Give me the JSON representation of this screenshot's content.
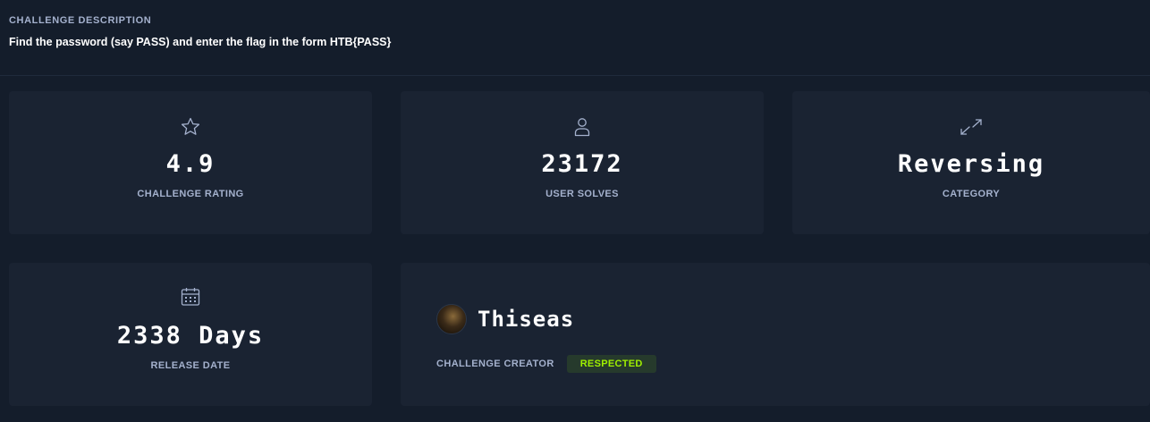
{
  "description": {
    "heading": "CHALLENGE DESCRIPTION",
    "text": "Find the password (say PASS) and enter the flag in the form HTB{PASS}"
  },
  "stats": [
    {
      "icon": "star-icon",
      "value": "4.9",
      "label": "CHALLENGE RATING"
    },
    {
      "icon": "user-icon",
      "value": "23172",
      "label": "USER SOLVES"
    },
    {
      "icon": "expand-arrows-icon",
      "value": "Reversing",
      "label": "CATEGORY"
    },
    {
      "icon": "calendar-icon",
      "value": "2338 Days",
      "label": "RELEASE DATE"
    }
  ],
  "creator": {
    "name": "Thiseas",
    "label": "CHALLENGE CREATOR",
    "badge": "RESPECTED"
  },
  "colors": {
    "background": "#141d2b",
    "card": "#1a2332",
    "label": "#a4b1cd",
    "badge_text": "#9fef00",
    "badge_bg": "#263a2c"
  }
}
